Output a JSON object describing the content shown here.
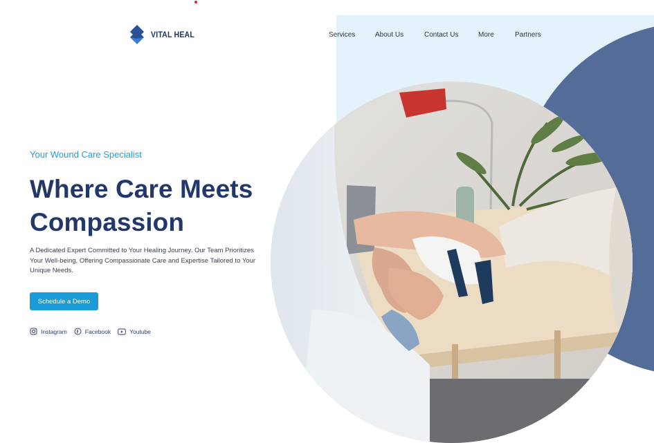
{
  "brand": {
    "name": "VITAL HEAL",
    "color": "#1e3566"
  },
  "nav": {
    "items": [
      {
        "label": "Services"
      },
      {
        "label": "About Us"
      },
      {
        "label": "Contact Us"
      },
      {
        "label": "More"
      },
      {
        "label": "Partners"
      }
    ]
  },
  "hero": {
    "kicker": "Your Wound Care Specialist",
    "title_line1": "Where Care Meets",
    "title_line2": "Compassion",
    "description": "A Dedicated Expert Committed to Your Healing Journey. Our Team Prioritizes Your Well-being, Offering Compassionate Care and Expertise Tailored to Your Unique Needs.",
    "cta_label": "Schedule a Demo",
    "image_icon": "doctor-fitting-wrist-brace-photo"
  },
  "social": [
    {
      "label": "Instagram",
      "icon": "instagram-icon"
    },
    {
      "label": "Facebook",
      "icon": "facebook-icon"
    },
    {
      "label": "Youtube",
      "icon": "youtube-icon"
    }
  ],
  "colors": {
    "accent": "#1a9ad6",
    "heading": "#22386a",
    "navy_shape": "#546c98",
    "light_shape": "#e3f2fb"
  }
}
